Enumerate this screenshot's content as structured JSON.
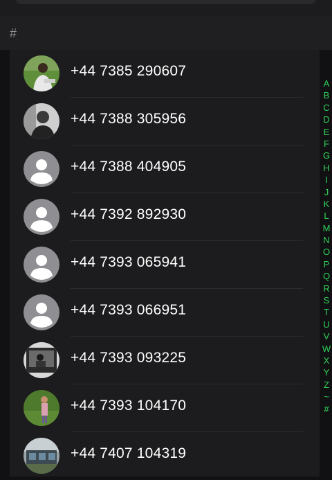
{
  "section": {
    "letter": "#"
  },
  "contacts": [
    {
      "phone": "+44 7385 290607",
      "avatar": "photo"
    },
    {
      "phone": "+44 7388 305956",
      "avatar": "photo"
    },
    {
      "phone": "+44 7388 404905",
      "avatar": "placeholder"
    },
    {
      "phone": "+44 7392 892930",
      "avatar": "placeholder"
    },
    {
      "phone": "+44 7393 065941",
      "avatar": "placeholder"
    },
    {
      "phone": "+44 7393 066951",
      "avatar": "placeholder"
    },
    {
      "phone": "+44 7393 093225",
      "avatar": "photo"
    },
    {
      "phone": "+44 7393 104170",
      "avatar": "photo"
    },
    {
      "phone": "+44 7407 104319",
      "avatar": "photo"
    }
  ],
  "index_letters": [
    "A",
    "B",
    "C",
    "D",
    "E",
    "F",
    "G",
    "H",
    "I",
    "J",
    "K",
    "L",
    "M",
    "N",
    "O",
    "P",
    "Q",
    "R",
    "S",
    "T",
    "U",
    "V",
    "W",
    "X",
    "Y",
    "Z",
    "~",
    "#"
  ],
  "colors": {
    "accent": "#30d158",
    "background": "#111113",
    "list_background": "#1c1c1e",
    "placeholder_avatar": "#8e8e93"
  }
}
